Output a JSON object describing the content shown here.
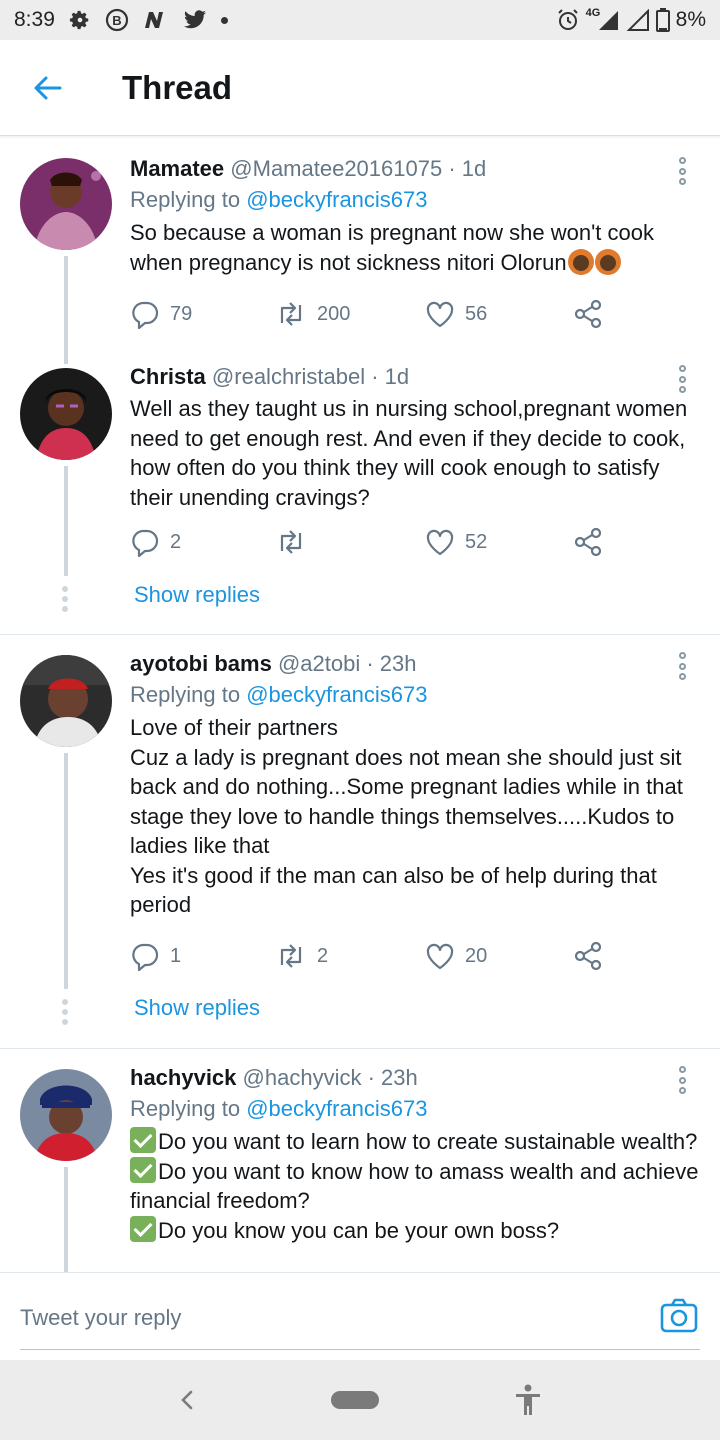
{
  "status_bar": {
    "time": "8:39",
    "network": "4G",
    "battery": "8%",
    "icons": [
      "settings-icon",
      "b-icon",
      "n-icon",
      "twitter-icon",
      "alarm-icon",
      "signal-icon",
      "battery-icon"
    ]
  },
  "header": {
    "title": "Thread"
  },
  "tweets": [
    {
      "name": "Mamatee",
      "handle": "@Mamatee20161075",
      "time": "· 1d",
      "replying_label": "Replying to",
      "replying_handle": "@beckyfrancis673",
      "text": "So because a woman is pregnant now she won't cook when pregnancy is not sickness nitori Olorun",
      "replies": "79",
      "retweets": "200",
      "likes": "56"
    },
    {
      "name": "Christa",
      "handle": "@realchristabel",
      "time": "· 1d",
      "text": "Well as they taught us in nursing school,pregnant women need to get enough rest. And even if they decide to cook, how often do you think they will cook enough to satisfy their unending cravings?",
      "replies": "2",
      "retweets": "",
      "likes": "52",
      "show_replies": "Show replies"
    },
    {
      "name": "ayotobi bams",
      "handle": "@a2tobi",
      "time": "· 23h",
      "replying_label": "Replying to",
      "replying_handle": "@beckyfrancis673",
      "text_lines": [
        "Love of their partners",
        "Cuz a lady is pregnant does not mean she should just sit back and do nothing...Some pregnant ladies while in that stage they love to handle things themselves.....Kudos to ladies like that",
        "Yes it's good if the man can also be of help during that period"
      ],
      "replies": "1",
      "retweets": "2",
      "likes": "20",
      "show_replies": "Show replies"
    },
    {
      "name": "hachyvick",
      "handle": "@hachyvick",
      "time": "· 23h",
      "replying_label": "Replying to",
      "replying_handle": "@beckyfrancis673",
      "text_lines": [
        "Do you want to learn how to create sustainable wealth?",
        "Do you want to know how to amass wealth and achieve financial freedom?",
        "Do you know you can be your own boss?"
      ]
    }
  ],
  "reply_bar": {
    "placeholder": "Tweet your reply"
  },
  "colors": {
    "accent": "#1b95e0",
    "text": "#14171a",
    "muted": "#657786"
  }
}
